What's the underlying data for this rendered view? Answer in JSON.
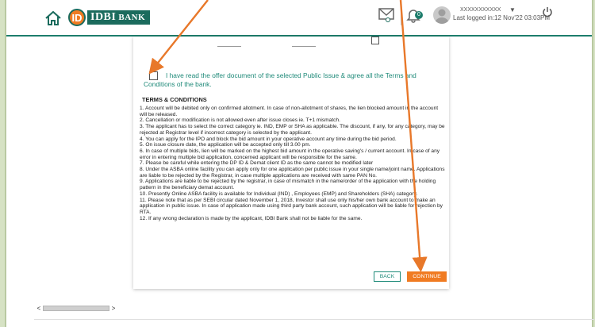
{
  "header": {
    "brand_initials": "ID",
    "brand_name": "IDBI",
    "brand_suffix": "BANK",
    "notifications_count": "0",
    "user_name": "XXXXXXXXXXX",
    "last_logged_in": "Last logged in:12 Nov'22 03:03PM"
  },
  "form": {
    "declaration": "I have read the offer document of the selected Public Issue & agree all the Terms and Conditions of the bank.",
    "terms_title": "TERMS & CONDITIONS",
    "terms": [
      "1. Account will be debited only on confirmed allotment. In case of non-allotment of shares, the lien blocked amount in the account will be released.",
      "2. Cancellation or modification is not allowed even after issue closes ie. T+1 mismatch.",
      "3. The applicant has to select the correct category ie. IND, EMP or SHA as applicable. The discount, if any, for any category, may be rejected at Registrar level if incorrect category is selected by the applicant.",
      "4. You can apply for the IPO and block the bid amount in your operative account any time during the bid period.",
      "5. On issue closure date, the application will be accepted only till 3.00 pm.",
      "6. In case of multiple bids, lien will be marked on the highest bid amount in the operative saving's / current account. In case of any error in entering multiple bid application, concerned applicant will be responsible for the same.",
      "7. Please be careful while entering the DP ID & Demat client ID as the same cannot be modified later",
      "8. Under the ASBA online facility you can apply only for one application per public issue in your single name/joint name. Applications are liable to be rejected by the Registrar, in case multiple applications are received with same PAN No.",
      "9. Applications are liable to be rejected by the registrar, in case of mismatch in the name/order of the application with the holding pattern in the beneficiary demat account.",
      "10. Presently Online ASBA facility is available for Individual (IND) , Employees (EMP) and Shareholders (SHA) category.",
      "11. Please note that as per SEBI circular dated November 1, 2018, Investor shall use only his/her own bank account to make an application in public issue. In case of application made using third party bank account, such application will be liable for rejection by RTA.",
      "12. If any wrong declaration is made by the applicant, IDBI Bank shall not be liable for the same."
    ],
    "back_label": "BACK",
    "continue_label": "CONTINUE"
  },
  "colors": {
    "brand_green": "#1b6b5d",
    "brand_orange": "#f07b22",
    "text_teal": "#1f8a79",
    "annotation_arrow": "#e8782a"
  }
}
